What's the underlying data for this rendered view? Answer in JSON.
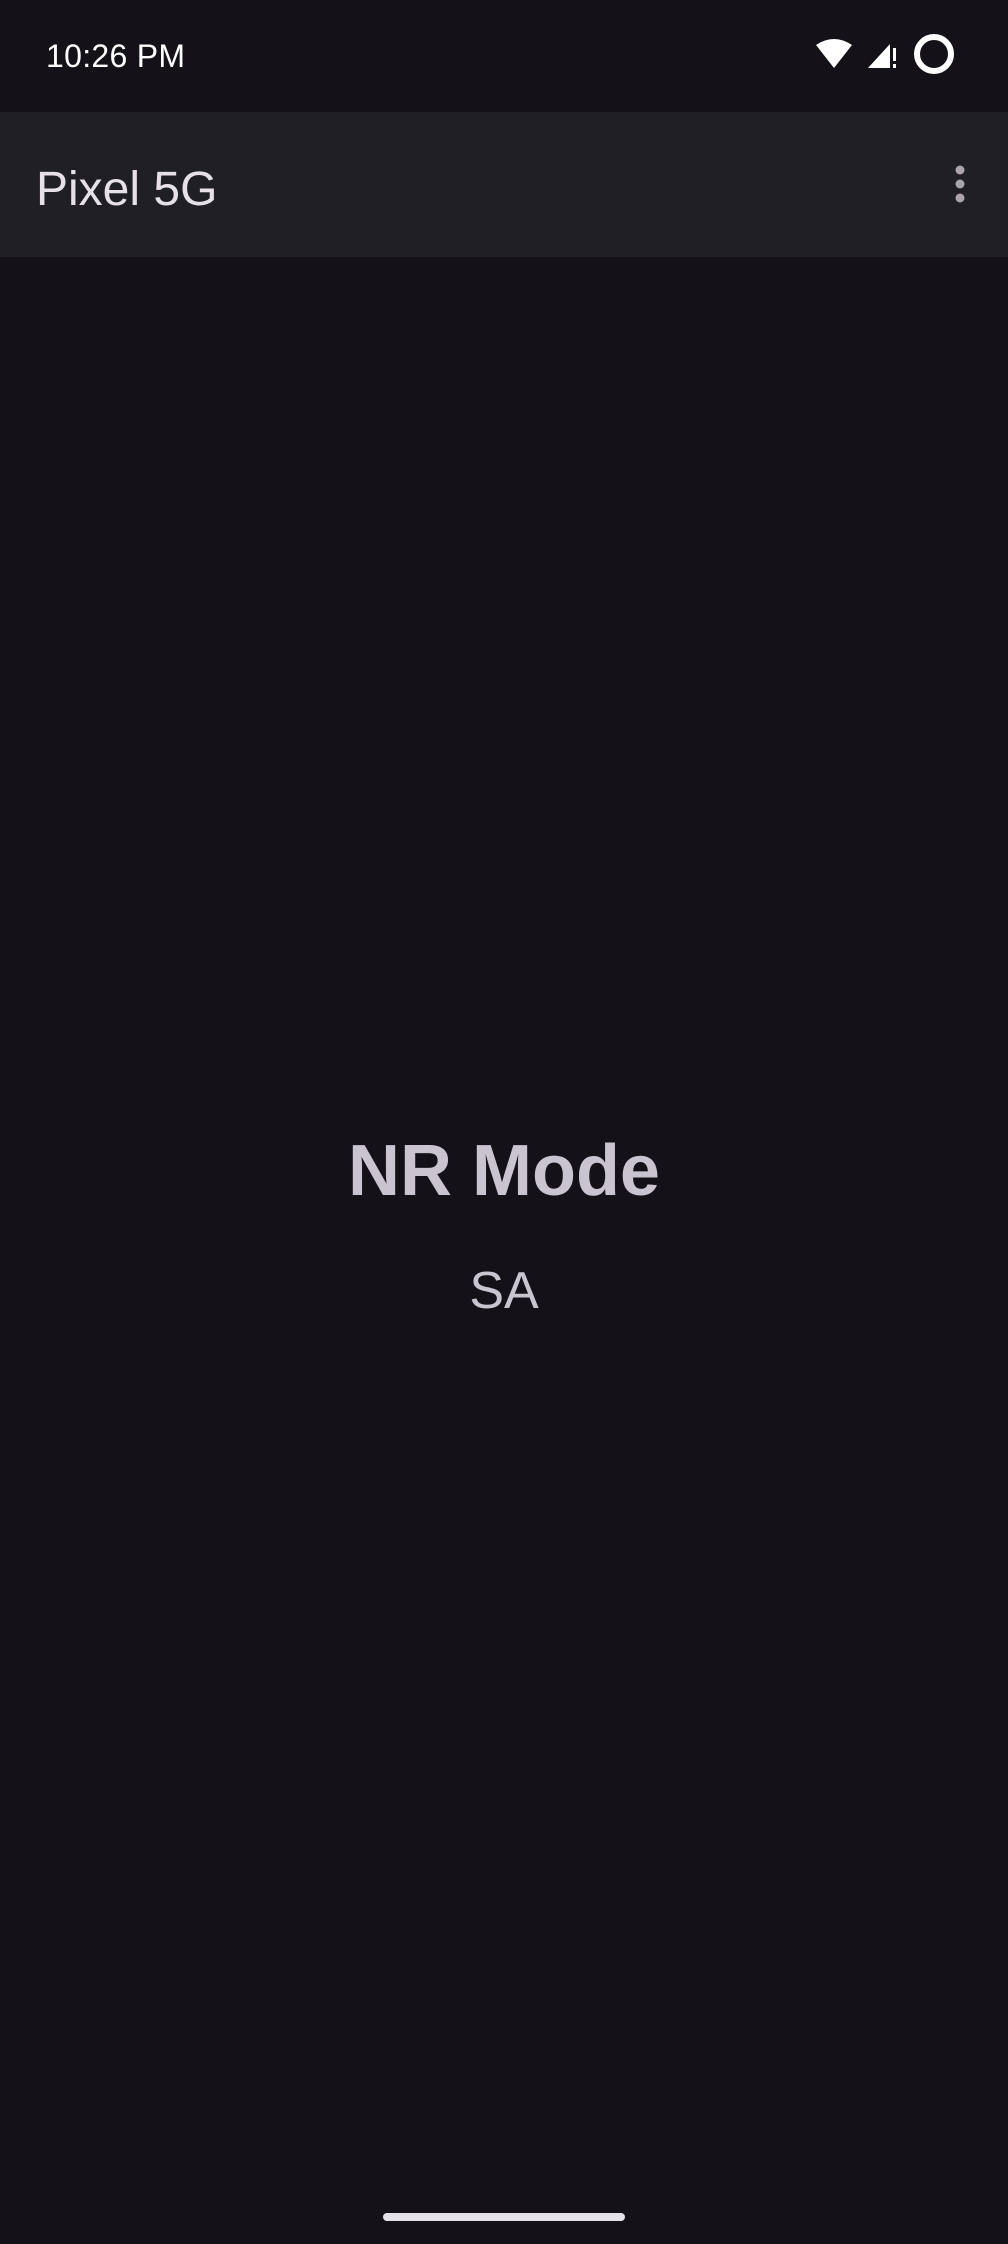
{
  "status_bar": {
    "time": "10:26 PM",
    "icons": [
      "wifi-icon",
      "cellular-signal-icon",
      "data-saver-circle-icon"
    ]
  },
  "app_bar": {
    "title": "Pixel 5G",
    "overflow_icon": "more-vert-icon"
  },
  "main": {
    "heading": "NR Mode",
    "value": "SA"
  },
  "colors": {
    "background": "#141218",
    "app_bar": "#211f26",
    "text_primary": "#e6e1e9",
    "text_secondary": "#cac4d0"
  }
}
